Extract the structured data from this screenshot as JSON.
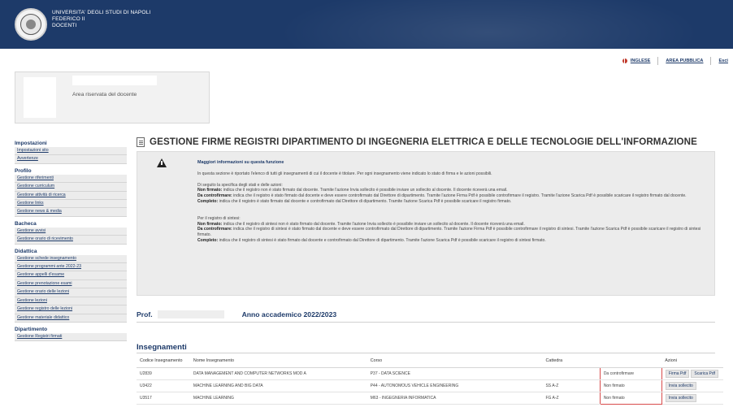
{
  "header": {
    "line1": "UNIVERSITA' DEGLI STUDI DI NAPOLI",
    "line2": "FEDERICO II",
    "line3": "DOCENTI"
  },
  "toplinks": {
    "inglese": "INGLESE",
    "area_pubblica": "AREA PUBBLICA",
    "esci": "Esci"
  },
  "area_box": {
    "label": "Area riservata del docente"
  },
  "sidebar": {
    "sections": [
      {
        "title": "Impostazioni",
        "items": [
          "Impostazioni sito",
          "Avvertenze"
        ]
      },
      {
        "title": "Profilo",
        "items": [
          "Gestione riferimenti",
          "Gestione curriculum",
          "Gestione attività di ricerca",
          "Gestione links",
          "Gestione news & media"
        ]
      },
      {
        "title": "Bacheca",
        "items": [
          "Gestione avvisi",
          "Gestione orario di ricevimento"
        ]
      },
      {
        "title": "Didattica",
        "items": [
          "Gestione schede insegnamento",
          "Gestione programmi ante 2022-23",
          "Gestione appelli d'esame",
          "Gestione prenotazione esami",
          "Gestione orario delle lezioni",
          "Gestione lezioni",
          "Gestione registro delle lezioni",
          "Gestione materiale didattico"
        ]
      },
      {
        "title": "Dipartimento",
        "items": [
          "Gestione Registri firmati"
        ]
      }
    ]
  },
  "main": {
    "title": "GESTIONE FIRME REGISTRI DIPARTIMENTO DI INGEGNERIA ELETTRICA E DELLE TECNOLOGIE DELL'INFORMAZIONE",
    "info": {
      "head": "Maggiori informazioni su questa funzione",
      "intro": "In questa sezione è riportato l'elenco di tutti gli insegnamenti di cui il docente è titolare. Per ogni insegnamento viene indicato lo stato di firma e le azioni possibili.",
      "states_intro": "Di seguito la specifica degli stati e delle azioni:",
      "s1_label": "Non firmato:",
      "s1_text": " indica che il registro non è stato firmato dal docente. Tramite l'azione Invia sollecito è possibile inviare un sollecito al docente. Il docente riceverà una email.",
      "s2_label": "Da controfirmare:",
      "s2_text": " indica che il registro è stato firmato dal docente e deve essere controfirmato dal Direttore di dipartimento. Tramite l'azione Firma Pdf è possibile controfirmare il registro. Tramite l'azione Scarica Pdf è possibile scaricare il registro firmato dal docente.",
      "s3_label": "Completo:",
      "s3_text": " indica che il registro è stato firmato dal docente e controfirmato dal Direttore di dipartimento. Tramite l'azione Scarica Pdf è possibile scaricare il registro firmato.",
      "sintesi_intro": "Per il registro di sintesi:",
      "t1_label": "Non firmato:",
      "t1_text": " indica che il registro di sintesi non è stato firmato dal docente. Tramite l'azione Invia sollecito è possibile inviare un sollecito al docente. Il docente riceverà una email.",
      "t2_label": "Da controfirmare:",
      "t2_text": " indica che il registro di sintesi è stato firmato dal docente e deve essere controfirmato dal Direttore di dipartimento. Tramite l'azione Firma Pdf è possibile controfirmare il registro di sintesi. Tramite l'azione Scarica Pdf è possibile scaricare il registro di sintesi firmato.",
      "t3_label": "Completo:",
      "t3_text": " indica che il registro di sintesi è stato firmato dal docente e controfirmato dal Direttore di dipartimento. Tramite l'azione Scarica Pdf è possibile scaricare il registro di sintesi firmato."
    },
    "prof_label": "Prof.",
    "anno": "Anno accademico 2022/2023",
    "insegnamenti_title": "Insegnamenti",
    "table": {
      "headers": [
        "Codice Insegnamento",
        "Nome Insegnamento",
        "Corso",
        "Cattedra",
        "",
        "Azioni"
      ],
      "rows": [
        {
          "codice": "U2839",
          "nome": "DATA MANAGEMENT AND COMPUTER NETWORKS MOD A",
          "corso": "P37 - DATA SCIENCE",
          "cattedra": "",
          "stato": "Da controfirmare",
          "azioni": [
            "Firma Pdf",
            "Scarica Pdf"
          ]
        },
        {
          "codice": "U3422",
          "nome": "MACHINE LEARNING AND BIG DATA",
          "corso": "P44 - AUTONOMOUS VEHICLE ENGINEERING",
          "cattedra": "SS A-Z",
          "stato": "Non firmato",
          "azioni": [
            "Invia sollecito"
          ]
        },
        {
          "codice": "U3517",
          "nome": "MACHINE LEARNING",
          "corso": "M63 - INGEGNERIA INFORMATICA",
          "cattedra": "FG A-Z",
          "stato": "Non firmato",
          "azioni": [
            "Invia sollecito"
          ]
        }
      ]
    }
  }
}
